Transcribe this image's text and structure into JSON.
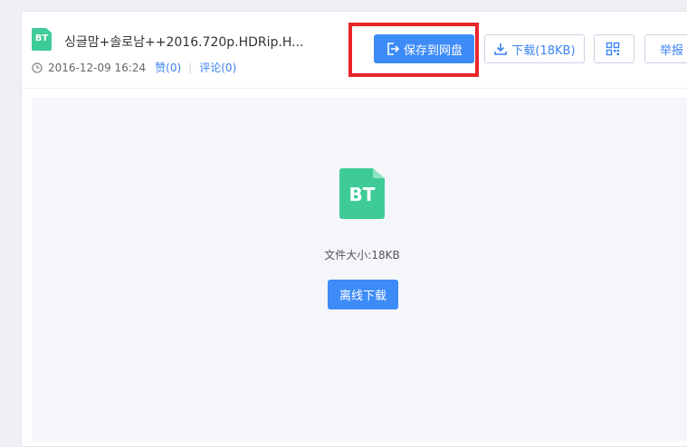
{
  "file": {
    "type_badge": "BT",
    "title": "싱글맘+솔로남++2016.720p.HDRip.H...",
    "date": "2016-12-09 16:24",
    "like_label": "赞(0)",
    "comment_label": "评论(0)"
  },
  "actions": {
    "save_label": "保存到网盘",
    "download_label": "下载(18KB)",
    "report_label": "举报"
  },
  "preview": {
    "type_badge": "BT",
    "size_text": "文件大小:18KB",
    "offline_label": "离线下载"
  },
  "colors": {
    "accent": "#3d8bf7",
    "file_icon": "#3ecb98",
    "highlight_border": "#e8262a"
  },
  "icons": {
    "save": "export-icon",
    "download": "download-icon",
    "qr": "qrcode-icon",
    "clock": "clock-icon"
  }
}
